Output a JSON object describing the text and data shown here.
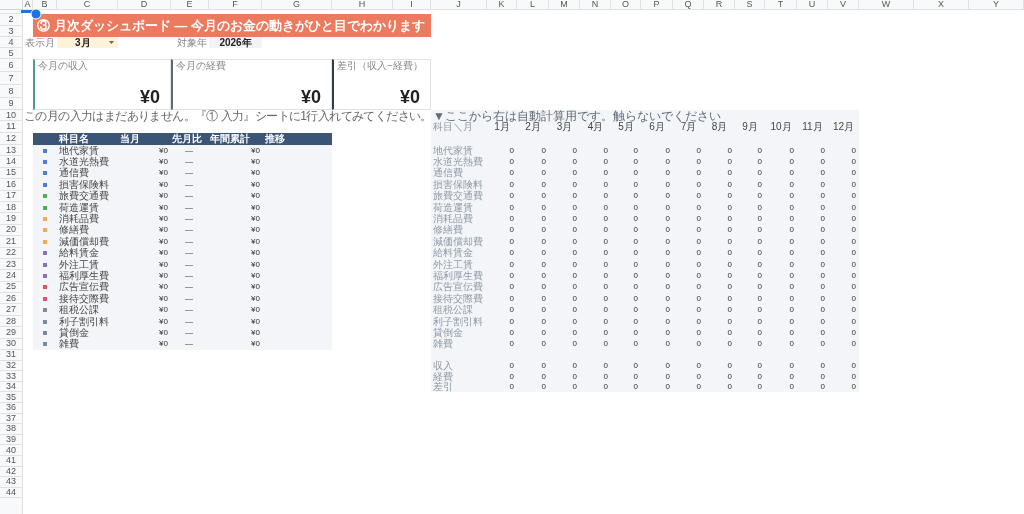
{
  "sheet": {
    "columns": [
      "A",
      "B",
      "C",
      "D",
      "E",
      "F",
      "G",
      "H",
      "I",
      "J",
      "K",
      "L",
      "M",
      "N",
      "O",
      "P",
      "Q",
      "R",
      "S",
      "T",
      "U",
      "V",
      "W",
      "X",
      "Y"
    ],
    "rows": [
      "2",
      "3",
      "4",
      "5",
      "6",
      "7",
      "8",
      "9",
      "10",
      "11",
      "12",
      "13",
      "14",
      "15",
      "16",
      "17",
      "18",
      "19",
      "20",
      "21",
      "22",
      "23",
      "24",
      "25",
      "26",
      "27",
      "28",
      "29",
      "30",
      "31",
      "32",
      "33",
      "34",
      "35",
      "36",
      "37",
      "38",
      "39",
      "40",
      "41",
      "42",
      "43",
      "44"
    ]
  },
  "title": "③ 月次ダッシュボード — 今月のお金の動きがひと目でわかります",
  "month_selector": {
    "label": "表示月",
    "value": "3月"
  },
  "year": {
    "label": "対象年",
    "value": "2026年"
  },
  "cards": [
    {
      "label": "今月の収入",
      "value": "¥0",
      "color": "#4e9a96"
    },
    {
      "label": "今月の経費",
      "value": "¥0",
      "color": "#5b6b7a"
    },
    {
      "label": "差引（収入−経費）",
      "value": "¥0",
      "color": "#2c3e50"
    }
  ],
  "notice": "この月の入力はまだありません。『① 入力』シートに1行入れてみてください。",
  "summary_table": {
    "columns": [
      "科目名",
      "当月",
      "先月比",
      "年間累計",
      "推移"
    ],
    "rows": [
      {
        "name": "地代家賃",
        "color": "#4a7fd4",
        "current": "¥0",
        "change": "—",
        "ytd": "¥0"
      },
      {
        "name": "水道光熱費",
        "color": "#4a7fd4",
        "current": "¥0",
        "change": "—",
        "ytd": "¥0"
      },
      {
        "name": "通信費",
        "color": "#4a7fd4",
        "current": "¥0",
        "change": "—",
        "ytd": "¥0"
      },
      {
        "name": "損害保険料",
        "color": "#4a7fd4",
        "current": "¥0",
        "change": "—",
        "ytd": "¥0"
      },
      {
        "name": "旅費交通費",
        "color": "#4caf50",
        "current": "¥0",
        "change": "—",
        "ytd": "¥0"
      },
      {
        "name": "荷造運賃",
        "color": "#4caf50",
        "current": "¥0",
        "change": "—",
        "ytd": "¥0"
      },
      {
        "name": "消耗品費",
        "color": "#f0ad4e",
        "current": "¥0",
        "change": "—",
        "ytd": "¥0"
      },
      {
        "name": "修繕費",
        "color": "#f0ad4e",
        "current": "¥0",
        "change": "—",
        "ytd": "¥0"
      },
      {
        "name": "減価償却費",
        "color": "#f0ad4e",
        "current": "¥0",
        "change": "—",
        "ytd": "¥0"
      },
      {
        "name": "給料賃金",
        "color": "#8e6cc0",
        "current": "¥0",
        "change": "—",
        "ytd": "¥0"
      },
      {
        "name": "外注工賃",
        "color": "#8e6cc0",
        "current": "¥0",
        "change": "—",
        "ytd": "¥0"
      },
      {
        "name": "福利厚生費",
        "color": "#8e6cc0",
        "current": "¥0",
        "change": "—",
        "ytd": "¥0"
      },
      {
        "name": "広告宣伝費",
        "color": "#e0506a",
        "current": "¥0",
        "change": "—",
        "ytd": "¥0"
      },
      {
        "name": "接待交際費",
        "color": "#e0506a",
        "current": "¥0",
        "change": "—",
        "ytd": "¥0"
      },
      {
        "name": "租税公課",
        "color": "#7a8a9a",
        "current": "¥0",
        "change": "—",
        "ytd": "¥0"
      },
      {
        "name": "利子割引料",
        "color": "#7a8a9a",
        "current": "¥0",
        "change": "—",
        "ytd": "¥0"
      },
      {
        "name": "貸倒金",
        "color": "#7a8a9a",
        "current": "¥0",
        "change": "—",
        "ytd": "¥0"
      },
      {
        "name": "雑費",
        "color": "#7a8a9a",
        "current": "¥0",
        "change": "—",
        "ytd": "¥0"
      }
    ]
  },
  "calc_area": {
    "note": "▼ここから右は自動計算用です。触らないでください",
    "corner": "科目＼月",
    "months": [
      "1月",
      "2月",
      "3月",
      "4月",
      "5月",
      "6月",
      "7月",
      "8月",
      "9月",
      "10月",
      "11月",
      "12月"
    ],
    "rows": [
      {
        "name": "地代家賃",
        "values": [
          "0",
          "0",
          "0",
          "0",
          "0",
          "0",
          "0",
          "0",
          "0",
          "0",
          "0",
          "0"
        ]
      },
      {
        "name": "水道光熱費",
        "values": [
          "0",
          "0",
          "0",
          "0",
          "0",
          "0",
          "0",
          "0",
          "0",
          "0",
          "0",
          "0"
        ]
      },
      {
        "name": "通信費",
        "values": [
          "0",
          "0",
          "0",
          "0",
          "0",
          "0",
          "0",
          "0",
          "0",
          "0",
          "0",
          "0"
        ]
      },
      {
        "name": "損害保険料",
        "values": [
          "0",
          "0",
          "0",
          "0",
          "0",
          "0",
          "0",
          "0",
          "0",
          "0",
          "0",
          "0"
        ]
      },
      {
        "name": "旅費交通費",
        "values": [
          "0",
          "0",
          "0",
          "0",
          "0",
          "0",
          "0",
          "0",
          "0",
          "0",
          "0",
          "0"
        ]
      },
      {
        "name": "荷造運賃",
        "values": [
          "0",
          "0",
          "0",
          "0",
          "0",
          "0",
          "0",
          "0",
          "0",
          "0",
          "0",
          "0"
        ]
      },
      {
        "name": "消耗品費",
        "values": [
          "0",
          "0",
          "0",
          "0",
          "0",
          "0",
          "0",
          "0",
          "0",
          "0",
          "0",
          "0"
        ]
      },
      {
        "name": "修繕費",
        "values": [
          "0",
          "0",
          "0",
          "0",
          "0",
          "0",
          "0",
          "0",
          "0",
          "0",
          "0",
          "0"
        ]
      },
      {
        "name": "減価償却費",
        "values": [
          "0",
          "0",
          "0",
          "0",
          "0",
          "0",
          "0",
          "0",
          "0",
          "0",
          "0",
          "0"
        ]
      },
      {
        "name": "給料賃金",
        "values": [
          "0",
          "0",
          "0",
          "0",
          "0",
          "0",
          "0",
          "0",
          "0",
          "0",
          "0",
          "0"
        ]
      },
      {
        "name": "外注工賃",
        "values": [
          "0",
          "0",
          "0",
          "0",
          "0",
          "0",
          "0",
          "0",
          "0",
          "0",
          "0",
          "0"
        ]
      },
      {
        "name": "福利厚生費",
        "values": [
          "0",
          "0",
          "0",
          "0",
          "0",
          "0",
          "0",
          "0",
          "0",
          "0",
          "0",
          "0"
        ]
      },
      {
        "name": "広告宣伝費",
        "values": [
          "0",
          "0",
          "0",
          "0",
          "0",
          "0",
          "0",
          "0",
          "0",
          "0",
          "0",
          "0"
        ]
      },
      {
        "name": "接待交際費",
        "values": [
          "0",
          "0",
          "0",
          "0",
          "0",
          "0",
          "0",
          "0",
          "0",
          "0",
          "0",
          "0"
        ]
      },
      {
        "name": "租税公課",
        "values": [
          "0",
          "0",
          "0",
          "0",
          "0",
          "0",
          "0",
          "0",
          "0",
          "0",
          "0",
          "0"
        ]
      },
      {
        "name": "利子割引料",
        "values": [
          "0",
          "0",
          "0",
          "0",
          "0",
          "0",
          "0",
          "0",
          "0",
          "0",
          "0",
          "0"
        ]
      },
      {
        "name": "貸倒金",
        "values": [
          "0",
          "0",
          "0",
          "0",
          "0",
          "0",
          "0",
          "0",
          "0",
          "0",
          "0",
          "0"
        ]
      },
      {
        "name": "雑費",
        "values": [
          "0",
          "0",
          "0",
          "0",
          "0",
          "0",
          "0",
          "0",
          "0",
          "0",
          "0",
          "0"
        ]
      }
    ],
    "totals": [
      {
        "name": "収入",
        "values": [
          "0",
          "0",
          "0",
          "0",
          "0",
          "0",
          "0",
          "0",
          "0",
          "0",
          "0",
          "0"
        ]
      },
      {
        "name": "経費",
        "values": [
          "0",
          "0",
          "0",
          "0",
          "0",
          "0",
          "0",
          "0",
          "0",
          "0",
          "0",
          "0"
        ]
      },
      {
        "name": "差引",
        "values": [
          "0",
          "0",
          "0",
          "0",
          "0",
          "0",
          "0",
          "0",
          "0",
          "0",
          "0",
          "0"
        ]
      }
    ]
  }
}
